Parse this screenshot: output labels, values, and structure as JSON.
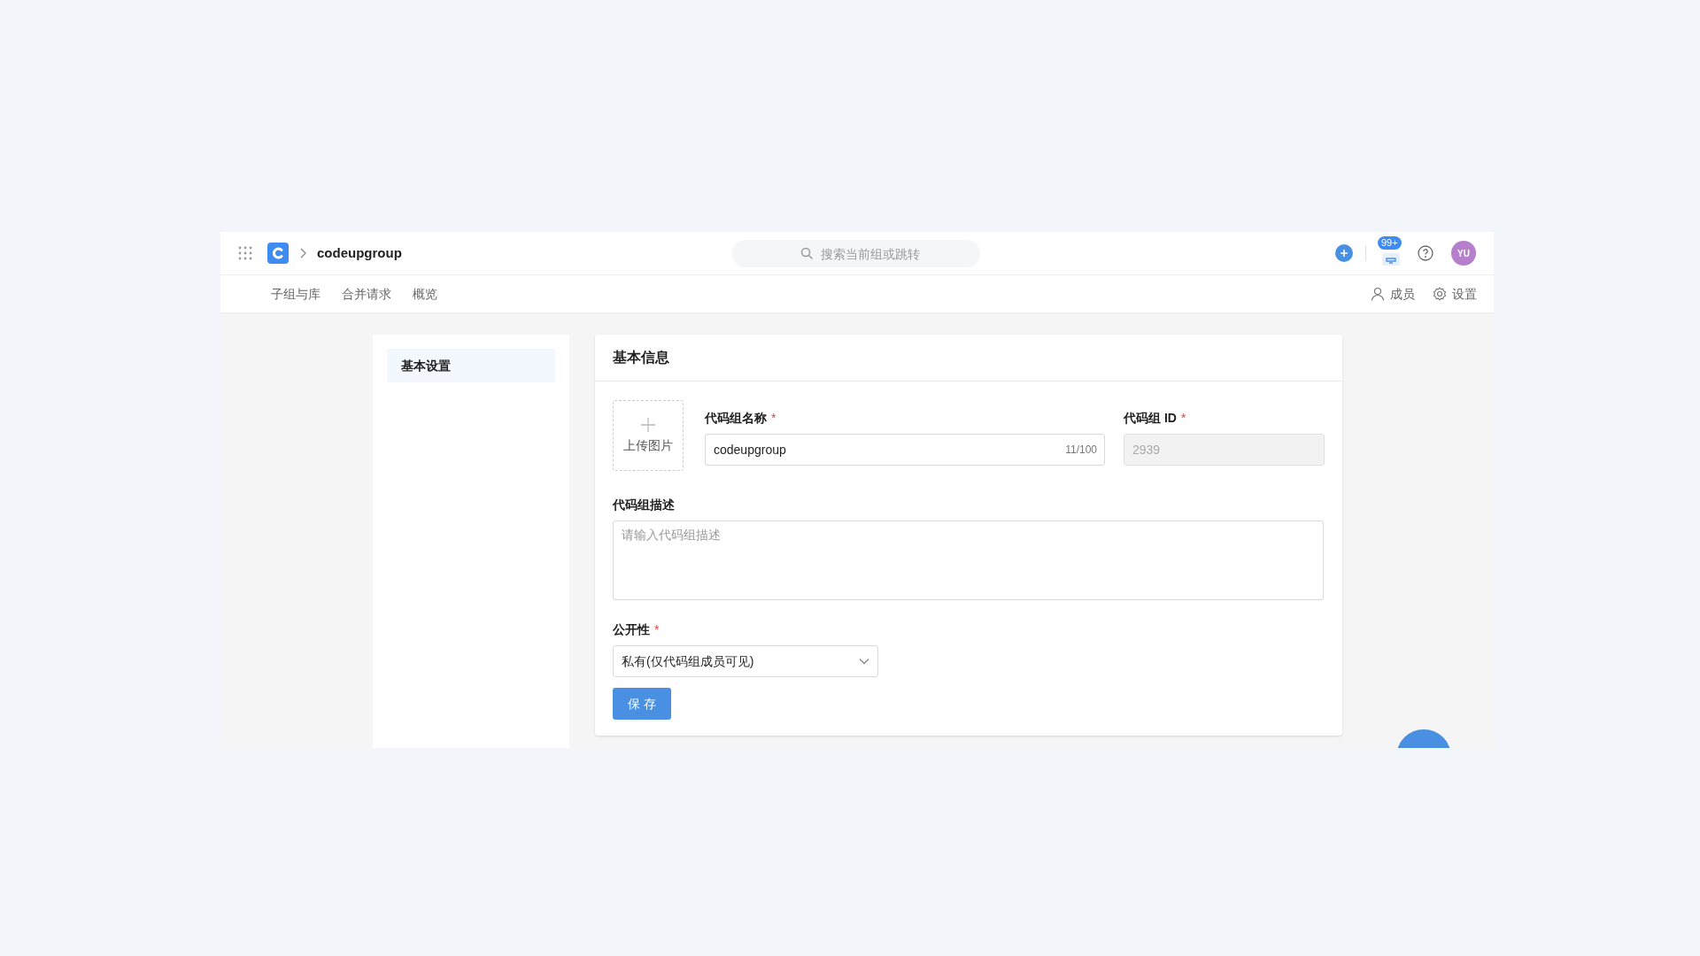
{
  "header": {
    "group_name": "codeupgroup",
    "search": {
      "placeholder": "搜索当前组或跳转"
    },
    "notification_badge": "99+",
    "avatar": "YU"
  },
  "nav_tabs": [
    {
      "label": "子组与库",
      "selected": false
    },
    {
      "label": "合并请求",
      "selected": false
    },
    {
      "label": "概览",
      "selected": false
    }
  ],
  "nav_actions": [
    {
      "kind": "members",
      "label": "成员"
    },
    {
      "kind": "settings",
      "label": "设置"
    }
  ],
  "sidebar": {
    "items": [
      {
        "label": "基本设置",
        "selected": true
      }
    ]
  },
  "card": {
    "title": "基本信息",
    "upload": {
      "label": "上传图片"
    },
    "name_field": {
      "label": "代码组名称",
      "required_mark": "*",
      "value": "codeupgroup",
      "counter": "11/100"
    },
    "id_field": {
      "label": "代码组 ID",
      "required_mark": "*",
      "value": "2939",
      "disabled": true
    },
    "description_field": {
      "label": "代码组描述",
      "placeholder": "请输入代码组描述"
    },
    "visibility_field": {
      "label": "公开性",
      "required_mark": "*",
      "value": "私有(仅代码组成员可见)"
    },
    "save_button": "保 存"
  }
}
